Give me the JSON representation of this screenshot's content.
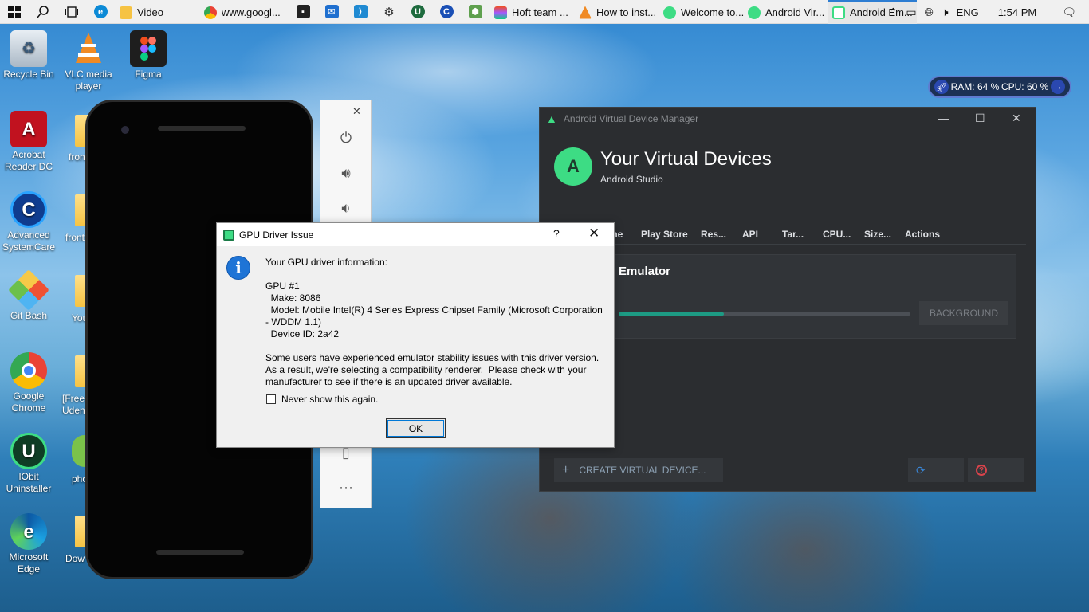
{
  "taskbar": {
    "tabs": [
      {
        "label": "Video",
        "color": "#f6c343"
      },
      {
        "label": "www.googl...",
        "color": "#4285f4"
      },
      {
        "label": "Hoft team ...",
        "color": "#e94e77"
      },
      {
        "label": "How to inst...",
        "color": "#f08a24"
      },
      {
        "label": "Welcome to...",
        "color": "#3ddc84"
      },
      {
        "label": "Android Vir...",
        "color": "#3ddc84"
      },
      {
        "label": "Android Em...",
        "color": "#3ddc84"
      }
    ],
    "language": "ENG",
    "time": "1:54 PM"
  },
  "desktop": {
    "icons": [
      {
        "label": "Recycle Bin"
      },
      {
        "label": "VLC media player"
      },
      {
        "label": "Figma"
      },
      {
        "label": "Acrobat Reader DC"
      },
      {
        "label": "Advanced SystemCare"
      },
      {
        "label": "Git Bash"
      },
      {
        "label": "Google Chrome"
      },
      {
        "label": "IObit Uninstaller"
      },
      {
        "label": "Microsoft Edge"
      }
    ],
    "partial_labels": [
      "fron",
      "front",
      "You",
      "[Free Uden",
      "pho",
      "Dow"
    ]
  },
  "ram_widget": {
    "ram": "RAM: 64 %",
    "cpu": "CPU: 60 %"
  },
  "emulator_toolbar": {
    "minimize": "–",
    "close": "✕"
  },
  "avd": {
    "window_title": "Android Virtual Device Manager",
    "heading": "Your Virtual Devices",
    "subheading": "Android Studio",
    "columns": [
      "me",
      "Play Store",
      "Res...",
      "API",
      "Tar...",
      "CPU...",
      "Size...",
      "Actions"
    ],
    "device_name": "Emulator",
    "progress": 0.36,
    "background_button": "BACKGROUND",
    "create_button": "CREATE VIRTUAL DEVICE..."
  },
  "dialog": {
    "title": "GPU Driver Issue",
    "help": "?",
    "message": "Your GPU driver information:\n\nGPU #1\n  Make: 8086\n  Model: Mobile Intel(R) 4 Series Express Chipset Family (Microsoft Corporation - WDDM 1.1)\n  Device ID: 2a42\n\nSome users have experienced emulator stability issues with this driver version.  As a result, we're selecting a compatibility renderer.  Please check with your manufacturer to see if there is an updated driver available.",
    "checkbox_label": "Never show this again.",
    "ok_label": "OK"
  }
}
